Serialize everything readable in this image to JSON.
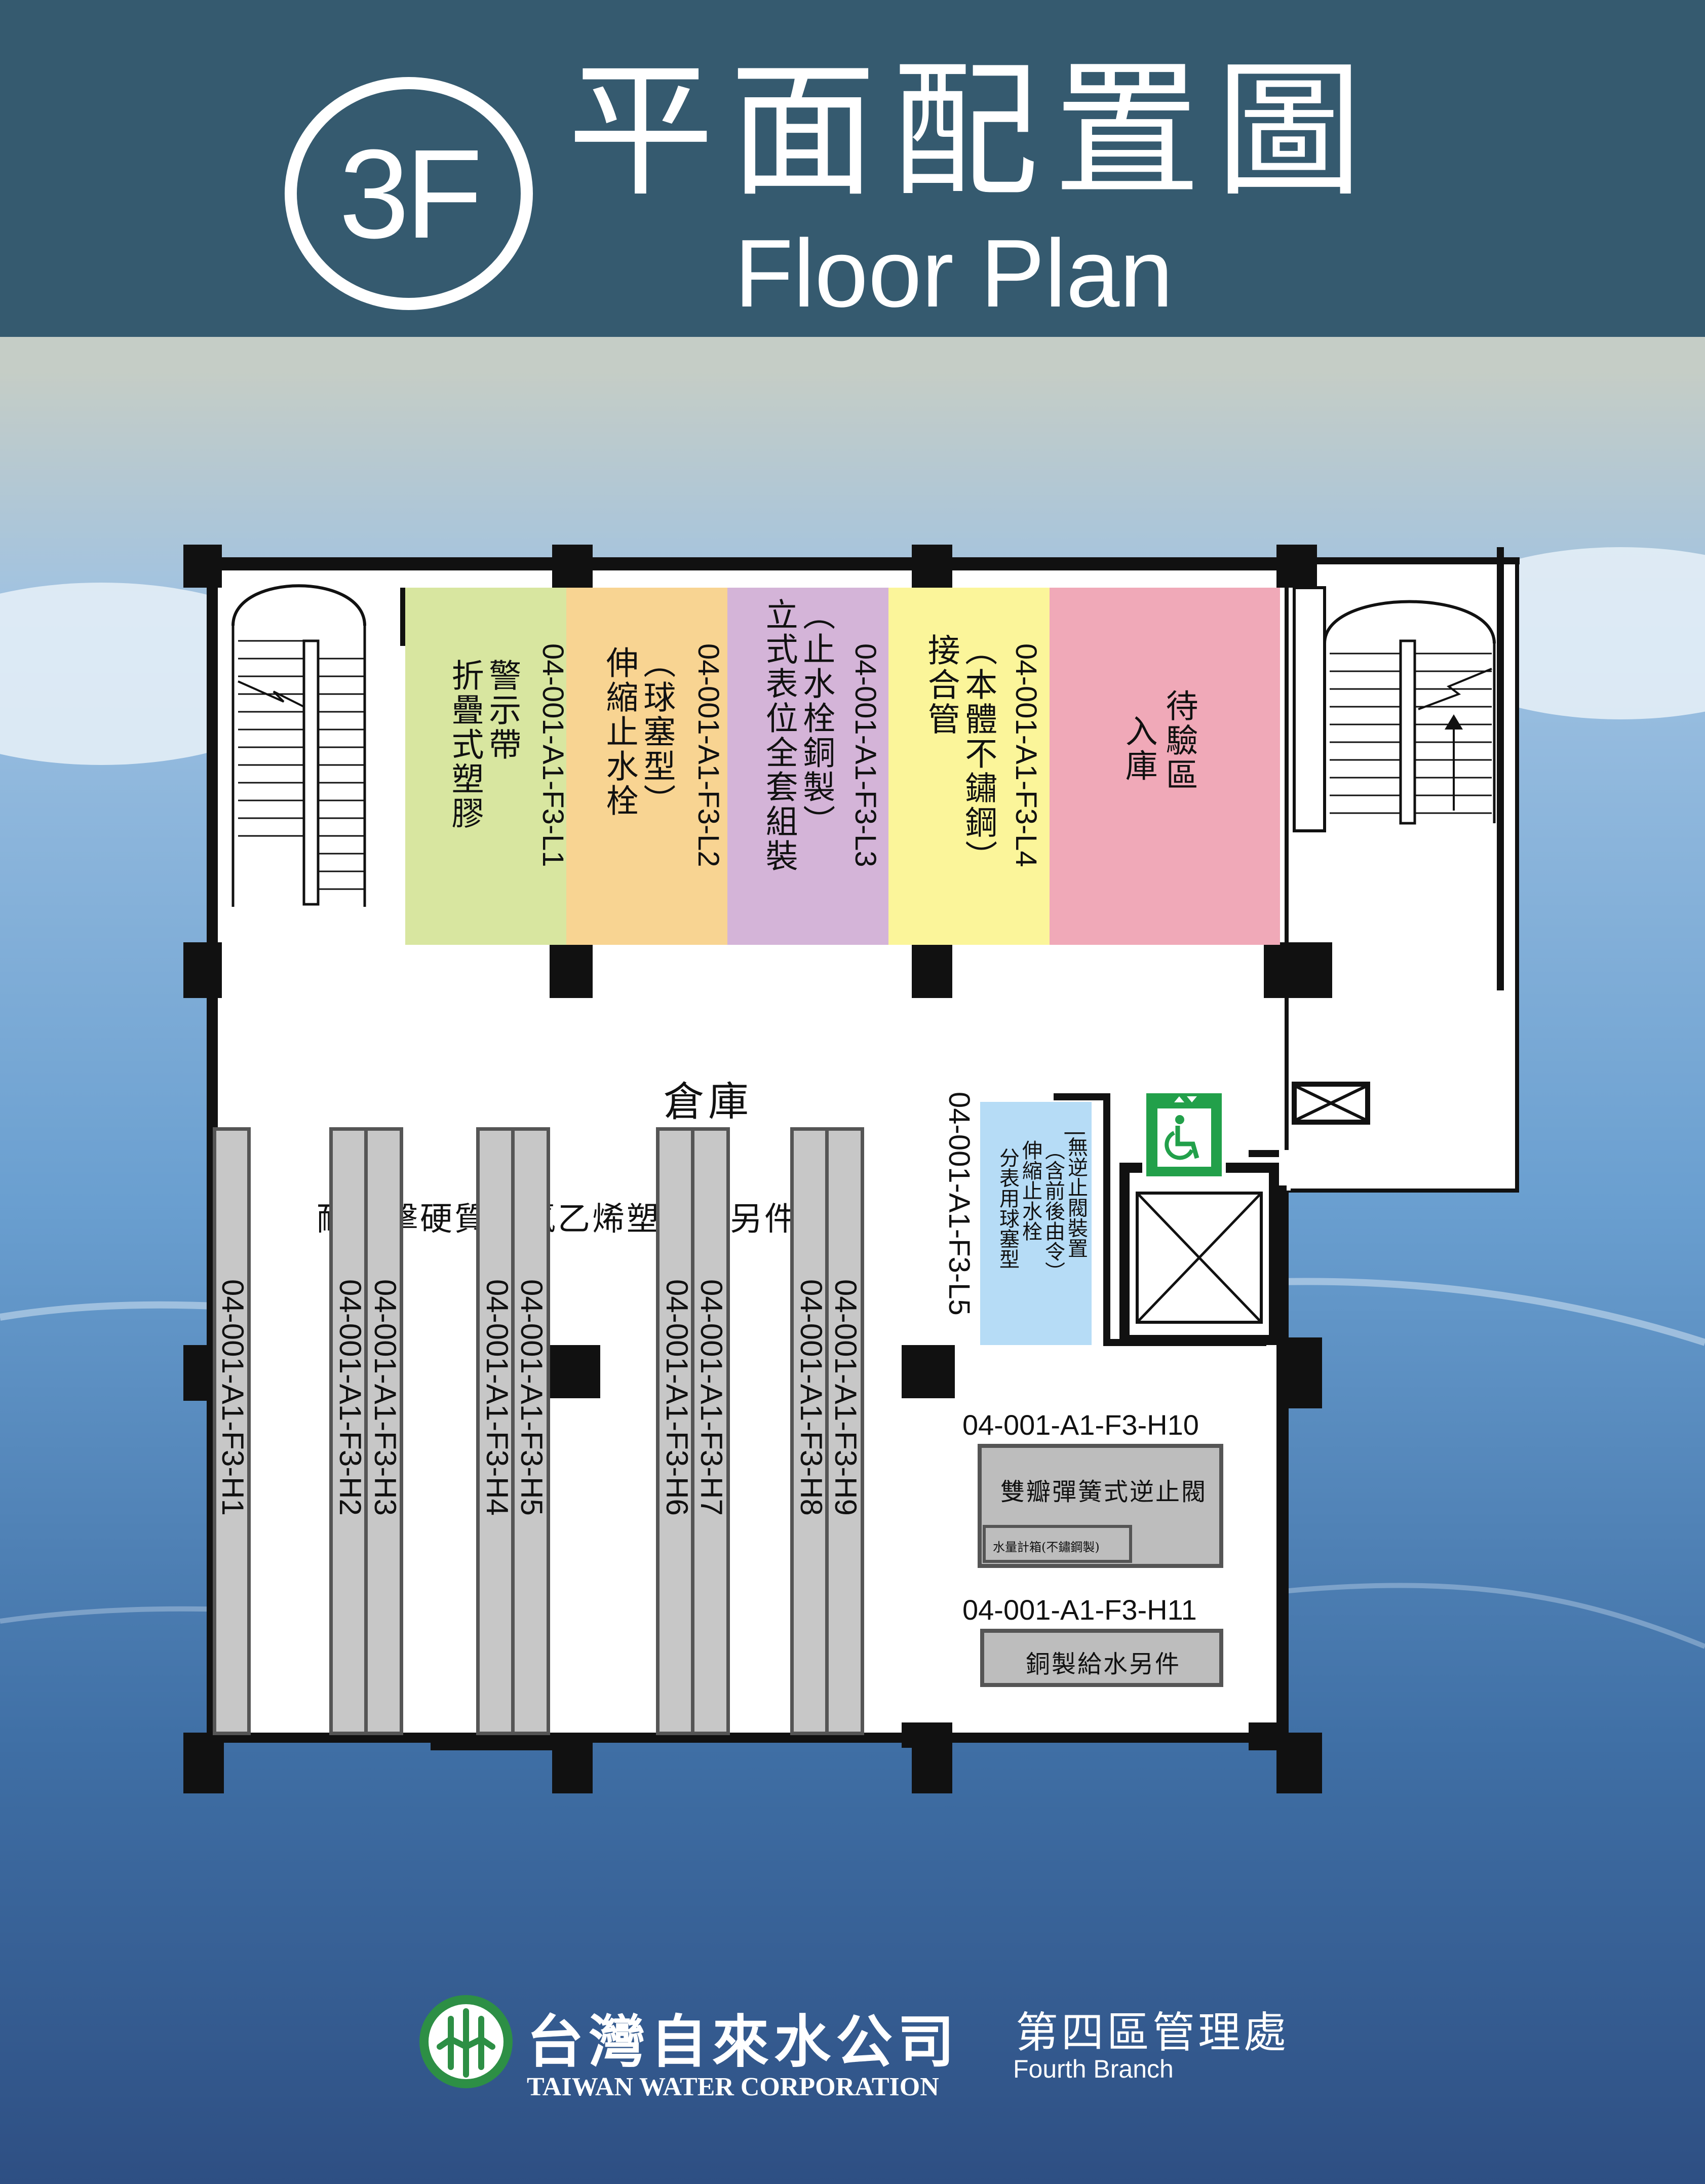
{
  "header": {
    "floor_badge": "3F",
    "title_zh": "平面配置圖",
    "title_en": "Floor Plan"
  },
  "colors": {
    "header_bg": "#355a6f",
    "zone_L1": "#d8e6a0",
    "zone_L2": "#f8d492",
    "zone_L3": "#d4b4d8",
    "zone_L4": "#fbf59a",
    "zone_pending": "#f0a9b8",
    "zone_L5": "#b6dcf6",
    "shelf": "#c7c7c7",
    "exit_green": "#22a04a"
  },
  "zones": [
    {
      "id": "L1",
      "code": "04-001-A1-F3-L1",
      "label": "警示帶\n折疊式塑膠"
    },
    {
      "id": "L2",
      "code": "04-001-A1-F3-L2",
      "label": "（球塞型）\n伸縮止水栓"
    },
    {
      "id": "L3",
      "code": "04-001-A1-F3-L3",
      "label": "（止水栓銅製）\n立式表位全套組裝"
    },
    {
      "id": "L4",
      "code": "04-001-A1-F3-L4",
      "label": "（本體不鏽鋼）\n接合管"
    },
    {
      "id": "pending",
      "label_line1": "待驗區",
      "label_line2": "入庫"
    }
  ],
  "warehouse_label": "倉庫",
  "pipe_label": "耐衝擊硬質聚氯乙烯塑膠管另件",
  "shelves": [
    "04-001-A1-F3-H1",
    "04-001-A1-F3-H2",
    "04-001-A1-F3-H3",
    "04-001-A1-F3-H4",
    "04-001-A1-F3-H5",
    "04-001-A1-F3-H6",
    "04-001-A1-F3-H7",
    "04-001-A1-F3-H8",
    "04-001-A1-F3-H9"
  ],
  "zone_L5": {
    "code": "04-001-A1-F3-L5",
    "line1": "|無逆止閥裝置",
    "line2": "（含前後由令）",
    "line3": "伸縮止水栓",
    "line4": "分表用球塞型"
  },
  "cabinets": [
    {
      "code": "04-001-A1-F3-H10",
      "label": "雙瓣彈簧式逆止閥",
      "sublabel": "水量計箱(不鏽鋼製)"
    },
    {
      "code": "04-001-A1-F3-H11",
      "label": "銅製給水另件"
    }
  ],
  "icons": [
    "stair-icon",
    "elevator-icon",
    "accessible-icon",
    "vent-icon"
  ],
  "footer": {
    "company_zh": "台灣自來水公司",
    "company_en": "TAIWAN WATER CORPORATION",
    "branch_zh": "第四區管理處",
    "branch_en": "Fourth Branch"
  }
}
